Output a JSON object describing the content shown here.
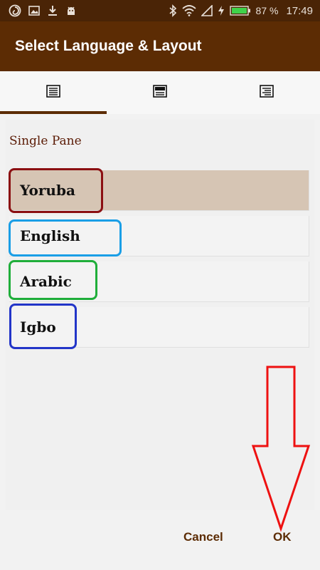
{
  "status_bar": {
    "battery_percent": "87 %",
    "time": "17:49",
    "icons": [
      "app-swirl-icon",
      "image-icon",
      "download-icon",
      "android-icon",
      "bluetooth-icon",
      "wifi-icon",
      "signal-icon",
      "charging-icon",
      "battery-icon"
    ]
  },
  "app_bar": {
    "title": "Select Language & Layout"
  },
  "tabs": [
    {
      "icon": "single-pane-layout-icon",
      "active": true
    },
    {
      "icon": "split-pane-layout-icon",
      "active": false
    },
    {
      "icon": "parallel-layout-icon",
      "active": false
    }
  ],
  "section": {
    "title": "Single Pane"
  },
  "languages": [
    {
      "label": "Yoruba",
      "selected": true,
      "highlight_color": "#8b0f12"
    },
    {
      "label": "English",
      "selected": false,
      "highlight_color": "#1a9ee6"
    },
    {
      "label": "Arabic",
      "selected": false,
      "highlight_color": "#1fae3a"
    },
    {
      "label": "Igbo",
      "selected": false,
      "highlight_color": "#2235c8"
    }
  ],
  "footer": {
    "cancel_label": "Cancel",
    "ok_label": "OK"
  },
  "colors": {
    "app_bar": "#5c2c04",
    "status_bar": "#4a2406",
    "selected_row": "#d6c5b4",
    "arrow": "#ee1111"
  }
}
